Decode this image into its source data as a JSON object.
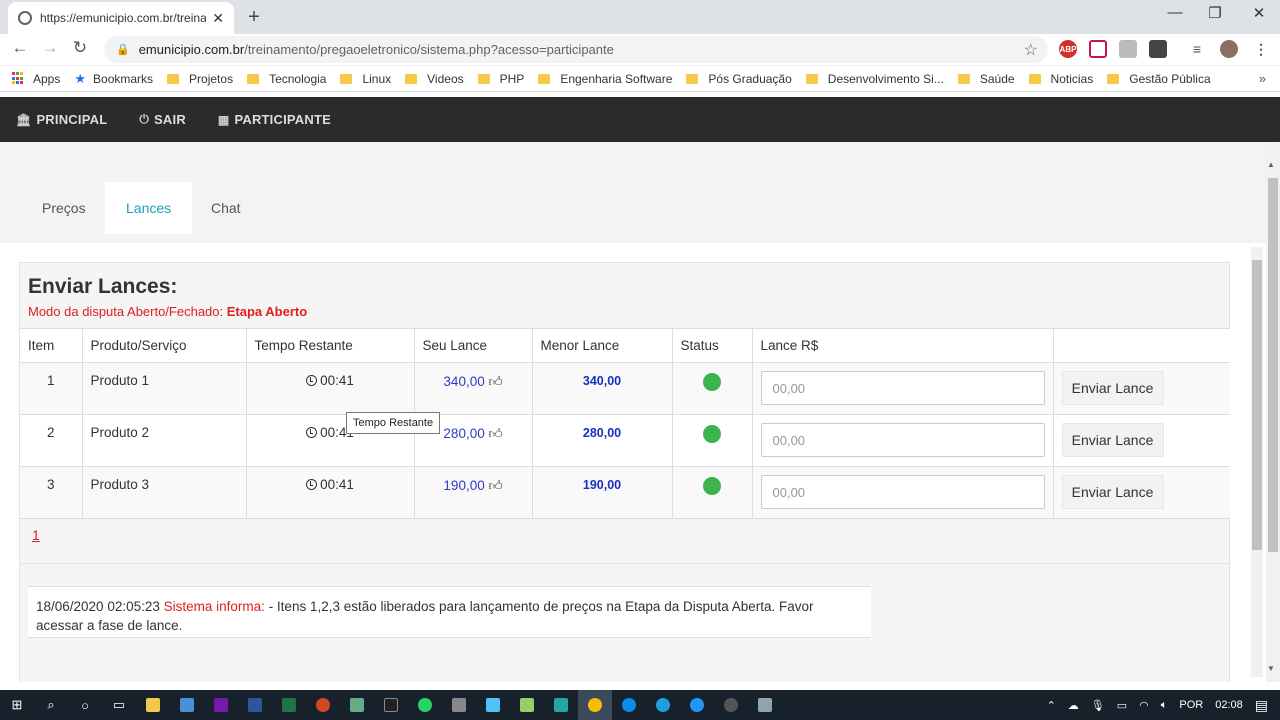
{
  "browser": {
    "tab_title": "https://emunicipio.com.br/treina",
    "url_domain": "emunicipio.com.br",
    "url_path": "/treinamento/pregaoeletronico/sistema.php?acesso=participante",
    "bookmarks": [
      "Apps",
      "Bookmarks",
      "Projetos",
      "Tecnologia",
      "Linux",
      "Videos",
      "PHP",
      "Engenharia Software",
      "Pós Graduação",
      "Desenvolvimento Si...",
      "Saúde",
      "Noticias",
      "Gestão Pública"
    ],
    "ext_abp": "ABP"
  },
  "site_nav": {
    "principal": "PRINCIPAL",
    "sair": "SAIR",
    "participante": "PARTICIPANTE"
  },
  "tabs": {
    "precos": "Preços",
    "lances": "Lances",
    "chat": "Chat"
  },
  "panel": {
    "title": "Enviar Lances:",
    "mode_label": "Modo da disputa Aberto/Fechado: ",
    "mode_value": "Etapa Aberto"
  },
  "table": {
    "headers": [
      "Item",
      "Produto/Serviço",
      "Tempo Restante",
      "Seu Lance",
      "Menor Lance",
      "Status",
      "Lance R$",
      ""
    ],
    "rows": [
      {
        "item": "1",
        "produto": "Produto 1",
        "tempo": "00:41",
        "seu_lance": "340,00",
        "menor_lance": "340,00",
        "lance_placeholder": "00,00",
        "button": "Enviar Lance"
      },
      {
        "item": "2",
        "produto": "Produto 2",
        "tempo": "00:41",
        "seu_lance": "280,00",
        "menor_lance": "280,00",
        "lance_placeholder": "00,00",
        "button": "Enviar Lance"
      },
      {
        "item": "3",
        "produto": "Produto 3",
        "tempo": "00:41",
        "seu_lance": "190,00",
        "menor_lance": "190,00",
        "lance_placeholder": "00,00",
        "button": "Enviar Lance"
      }
    ]
  },
  "pagination": {
    "page": "1"
  },
  "tooltip": "Tempo Restante",
  "message": {
    "timestamp": "18/06/2020 02:05:23",
    "sender": "Sistema informa:",
    "text": " - Itens 1,2,3 estão liberados para lançamento de preços na Etapa da Disputa Aberta. Favor acessar a fase de lance."
  },
  "taskbar": {
    "lang": "POR",
    "time": "02:08"
  },
  "colors": {
    "nav_bg": "#2b2b2b",
    "active_tab": "#17a2b8",
    "status_ok": "#3cb44b",
    "alert_red": "#e02020",
    "bid_blue": "#2b3dbf"
  }
}
